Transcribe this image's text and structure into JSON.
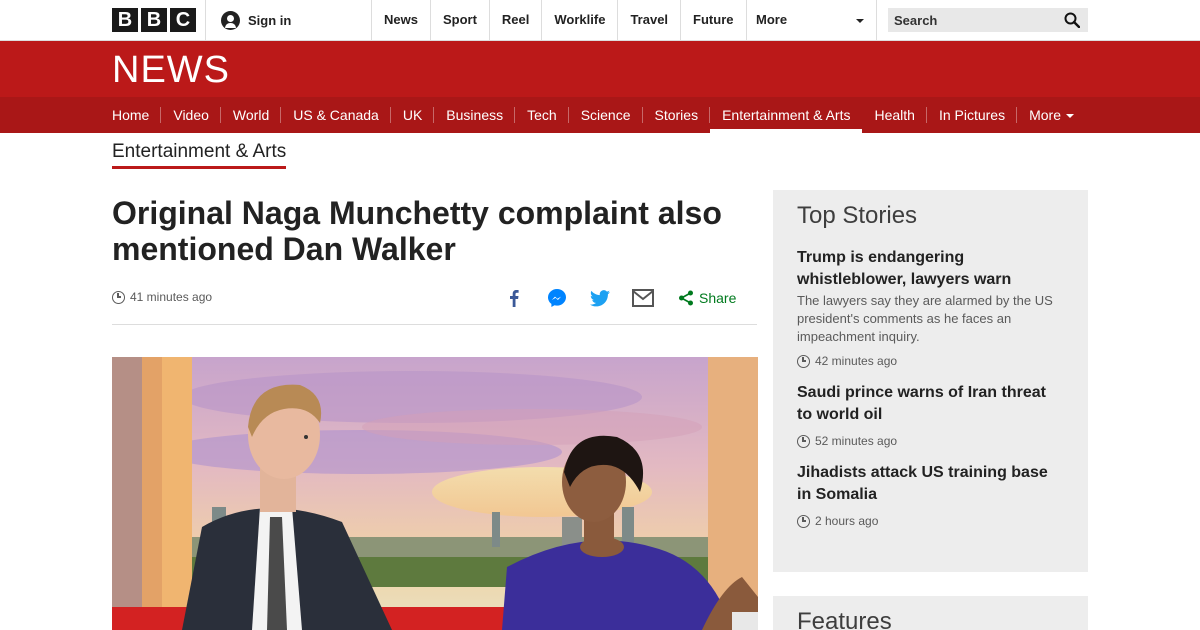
{
  "brand": {
    "logo_letters": [
      "B",
      "B",
      "C"
    ],
    "section_title": "NEWS"
  },
  "signin": {
    "label": "Sign in"
  },
  "global_nav": {
    "items": [
      "News",
      "Sport",
      "Reel",
      "Worklife",
      "Travel",
      "Future"
    ],
    "more_label": "More"
  },
  "search": {
    "placeholder": "Search"
  },
  "news_nav": {
    "items": [
      "Home",
      "Video",
      "World",
      "US & Canada",
      "UK",
      "Business",
      "Tech",
      "Science",
      "Stories",
      "Entertainment & Arts",
      "Health",
      "In Pictures",
      "More"
    ],
    "active": "Entertainment & Arts"
  },
  "article": {
    "section": "Entertainment & Arts",
    "headline": "Original Naga Munchetty complaint also mentioned Dan Walker",
    "timestamp": "41 minutes ago",
    "share_label": "Share"
  },
  "sidebar": {
    "top_stories_title": "Top Stories",
    "stories": [
      {
        "title": "Trump is endangering whistleblower, lawyers warn",
        "summary": "The lawyers say they are alarmed by the US president's comments as he faces an impeachment inquiry.",
        "time": "42 minutes ago"
      },
      {
        "title": "Saudi prince warns of Iran threat to world oil",
        "summary": "",
        "time": "52 minutes ago"
      },
      {
        "title": "Jihadists attack US training base in Somalia",
        "summary": "",
        "time": "2 hours ago"
      }
    ],
    "features_title": "Features"
  },
  "colors": {
    "brand_red": "#bb1919",
    "nav_red": "#a91717",
    "share_green": "#007a1e",
    "sidebar_bg": "#ededed"
  },
  "icons": [
    "person-icon",
    "search-icon",
    "clock-icon",
    "facebook-icon",
    "messenger-icon",
    "twitter-icon",
    "email-icon",
    "share-icon"
  ]
}
